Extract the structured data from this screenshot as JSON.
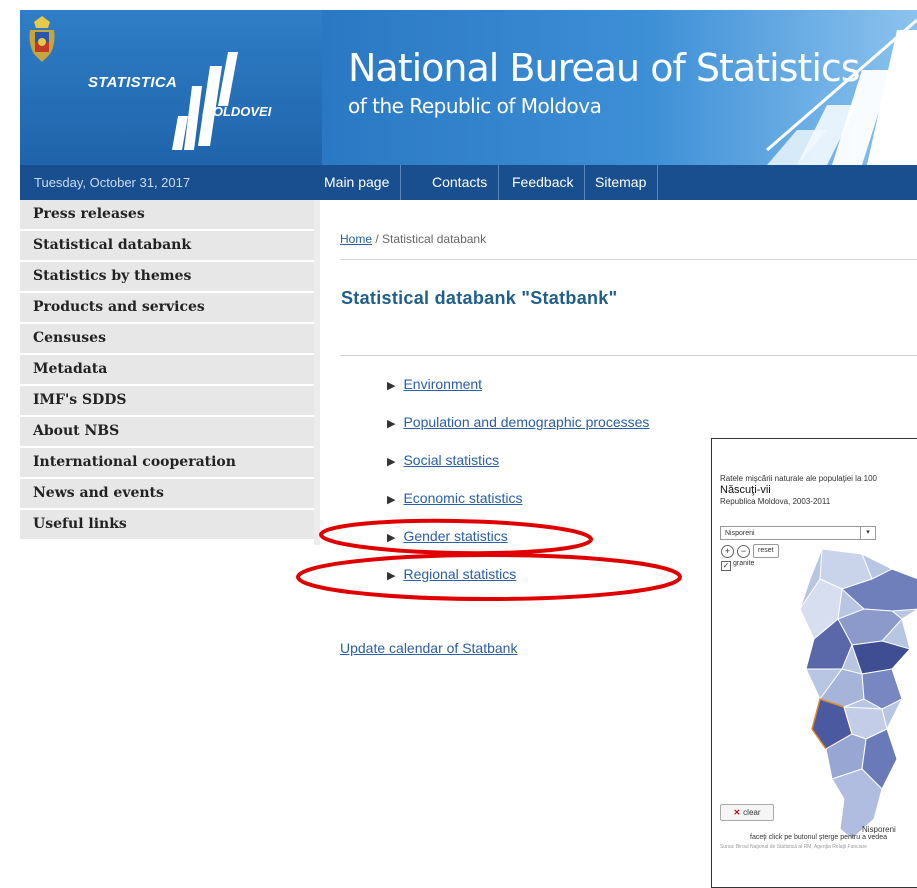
{
  "header": {
    "logo_line1": "STATISTICA",
    "logo_line2": "MOLDOVEI",
    "title": "National Bureau of Statistics",
    "subtitle": "of the Republic of Moldova"
  },
  "date": "Tuesday, October 31, 2017",
  "topnav": [
    {
      "label": "Main page"
    },
    {
      "label": "Contacts"
    },
    {
      "label": "Feedback"
    },
    {
      "label": "Sitemap"
    }
  ],
  "sidebar": {
    "items": [
      {
        "label": "Press releases"
      },
      {
        "label": "Statistical databank"
      },
      {
        "label": "Statistics by themes"
      },
      {
        "label": "Products and services"
      },
      {
        "label": "Censuses"
      },
      {
        "label": "Metadata"
      },
      {
        "label": "IMF's SDDS"
      },
      {
        "label": "About NBS"
      },
      {
        "label": "International cooperation"
      },
      {
        "label": "News and events"
      },
      {
        "label": "Useful links"
      }
    ]
  },
  "breadcrumb": {
    "home": "Home",
    "separator": " / ",
    "current": "Statistical databank"
  },
  "page_title": "Statistical databank \"Statbank\"",
  "categories": [
    {
      "label": "Environment"
    },
    {
      "label": "Population and demographic processes"
    },
    {
      "label": "Social statistics"
    },
    {
      "label": "Economic statistics"
    },
    {
      "label": "Gender statistics"
    },
    {
      "label": "Regional statistics"
    }
  ],
  "update_link": "Update calendar of Statbank",
  "map_widget": {
    "caption": "Ratele mişcării naturale ale populaţiei la 100",
    "title": "Născuţi-vii",
    "subtitle": "Republica Moldova, 2003-2011",
    "select_value": "Nisporeni",
    "zoom_in": "+",
    "zoom_out": "−",
    "reset": "reset",
    "checkbox_label": "granite",
    "clear": "clear",
    "region_label": "Nisporeni",
    "hint": "faceţi click pe butonul şterge pentru a vedea",
    "source": "Sursa: Biroul Naţional de Statistică al RM, Agenţia Relaţii Funciare"
  },
  "colors": {
    "header_blue": "#2a78c3",
    "nav_dark_blue": "#1a4f8f",
    "title_blue": "#1f5f8b",
    "link_blue": "#2a5ea8",
    "annotation_red": "#e00000",
    "sidebar_bg": "#e7e7e7"
  }
}
